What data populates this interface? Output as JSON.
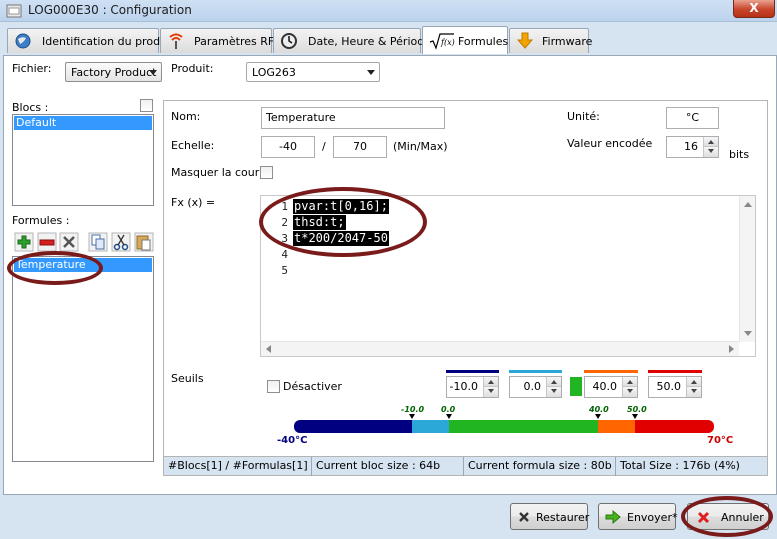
{
  "window": {
    "title": "LOG000E30 : Configuration",
    "close_glyph": "X"
  },
  "tabs": [
    {
      "label": "Identification du produit",
      "icon": "globe-icon",
      "active": false
    },
    {
      "label": "Paramètres RF",
      "icon": "antenna-icon",
      "active": false
    },
    {
      "label": "Date, Heure & Périodes",
      "icon": "clock-icon",
      "active": false
    },
    {
      "label": "Formules",
      "icon": "sqrt-fx-icon",
      "active": true
    },
    {
      "label": "Firmware",
      "icon": "download-arrow-icon",
      "active": false
    }
  ],
  "header": {
    "fichier_label": "Fichier:",
    "fichier_value": "Factory Product",
    "produit_label": "Produit:",
    "produit_value": "LOG263"
  },
  "blocs": {
    "label": "Blocs :",
    "items": [
      "Default"
    ],
    "selected": "Default"
  },
  "formules": {
    "label": "Formules :",
    "items": [
      "Temperature"
    ],
    "selected": "Temperature"
  },
  "form": {
    "nom_label": "Nom:",
    "nom_value": "Temperature",
    "unite_label": "Unité:",
    "unite_value": "°C",
    "echelle_label": "Echelle:",
    "echelle_min": "-40",
    "echelle_sep": "/",
    "echelle_max": "70",
    "echelle_unit": "(Min/Max)",
    "valeur_label": "Valeur encodée",
    "valeur_value": "16",
    "valeur_unit": "bits",
    "masquer_label": "Masquer la courbe",
    "fx_label": "Fx (x) ="
  },
  "code": {
    "line_numbers": [
      "1",
      "2",
      "3",
      "4",
      "5"
    ],
    "lines": [
      "pvar:t[0,16];",
      "thsd:t;",
      "t*200/2047-50"
    ]
  },
  "seuils": {
    "label": "Seuils",
    "desactiver_label": "Désactiver",
    "values": [
      "-10.0",
      "0.0",
      "40.0",
      "50.0"
    ],
    "colors": [
      "#000080",
      "#2ba8d8",
      "#22b522",
      "#ff6600",
      "#e00000"
    ],
    "gauge": {
      "min_label": "-40°C",
      "max_label": "70°C",
      "ticks": [
        "-10.0",
        "0.0",
        "40.0",
        "50.0"
      ]
    }
  },
  "status": {
    "blocs": "#Blocs[1] / #Formulas[1]",
    "bloc_size": "Current bloc size : 64b",
    "formula_size": "Current formula size : 80b",
    "total": "Total Size : 176b (4%)"
  },
  "buttons": {
    "restaurer": "Restaurer",
    "envoyer": "Envoyer*",
    "annuler": "Annuler"
  }
}
